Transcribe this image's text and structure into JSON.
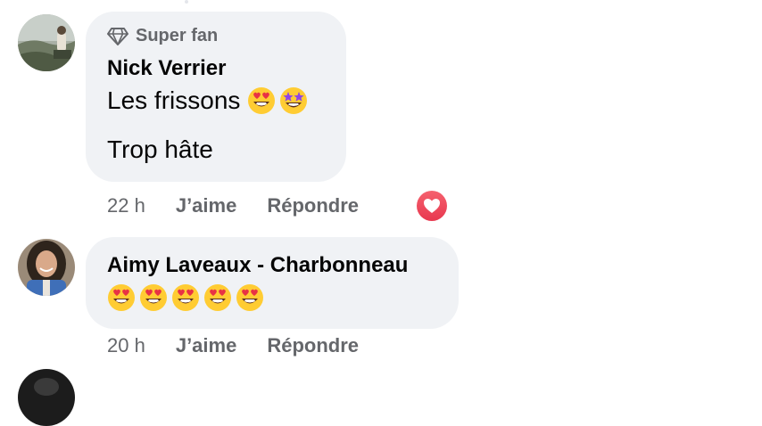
{
  "comments": [
    {
      "badge": "Super fan",
      "badge_icon": "diamond-icon",
      "author": "Nick Verrier",
      "lines": [
        "Les frissons",
        "Trop hâte"
      ],
      "line1_emojis": [
        "heart-eyes-emoji",
        "star-struck-emoji"
      ],
      "time": "22 h",
      "like_label": "J’aime",
      "reply_label": "Répondre",
      "reaction": "love-reaction-icon"
    },
    {
      "author": "Aimy Laveaux - Charbonneau",
      "emojis": [
        "heart-eyes-emoji",
        "heart-eyes-emoji",
        "heart-eyes-emoji",
        "heart-eyes-emoji",
        "heart-eyes-emoji"
      ],
      "time": "20 h",
      "like_label": "J’aime",
      "reply_label": "Répondre"
    }
  ],
  "colors": {
    "bubble": "#f0f2f5",
    "secondary_text": "#65676b",
    "primary_text": "#050505",
    "love_reaction": "#f0384f"
  }
}
